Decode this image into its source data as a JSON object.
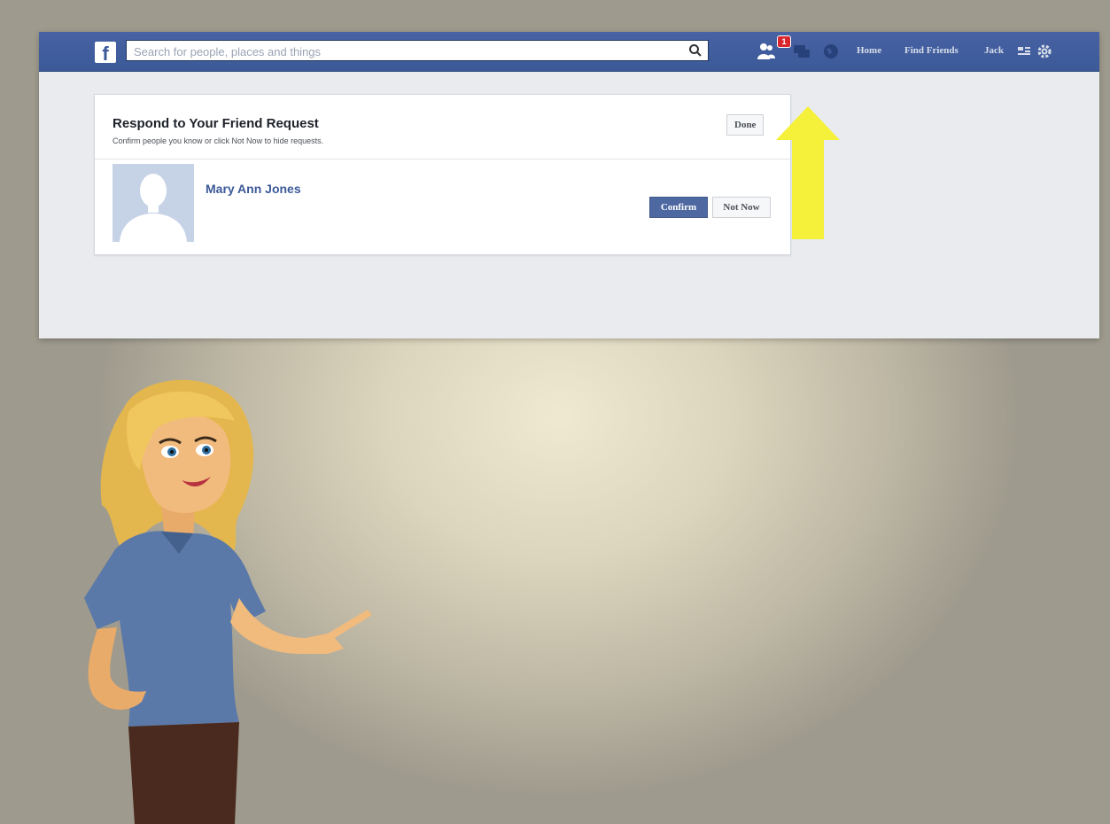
{
  "topbar": {
    "logo": "f",
    "search_placeholder": "Search for people, places and things",
    "notification_count": "1",
    "nav_links": [
      "Home",
      "Find Friends",
      "Jack"
    ]
  },
  "friend_request": {
    "title": "Respond to Your Friend Request",
    "subtitle": "Confirm people you know or click Not Now to hide requests.",
    "done_label": "Done",
    "requests": [
      {
        "name": "Mary Ann Jones",
        "confirm_label": "Confirm",
        "not_now_label": "Not Now"
      }
    ]
  },
  "colors": {
    "brand": "#3b5998",
    "arrow": "#f5f03a",
    "badge": "#d9262d"
  },
  "icons": [
    "friend-requests-icon",
    "messages-icon",
    "notifications-globe-icon",
    "search-icon",
    "settings-gear-icon",
    "privacy-shortcuts-icon"
  ]
}
